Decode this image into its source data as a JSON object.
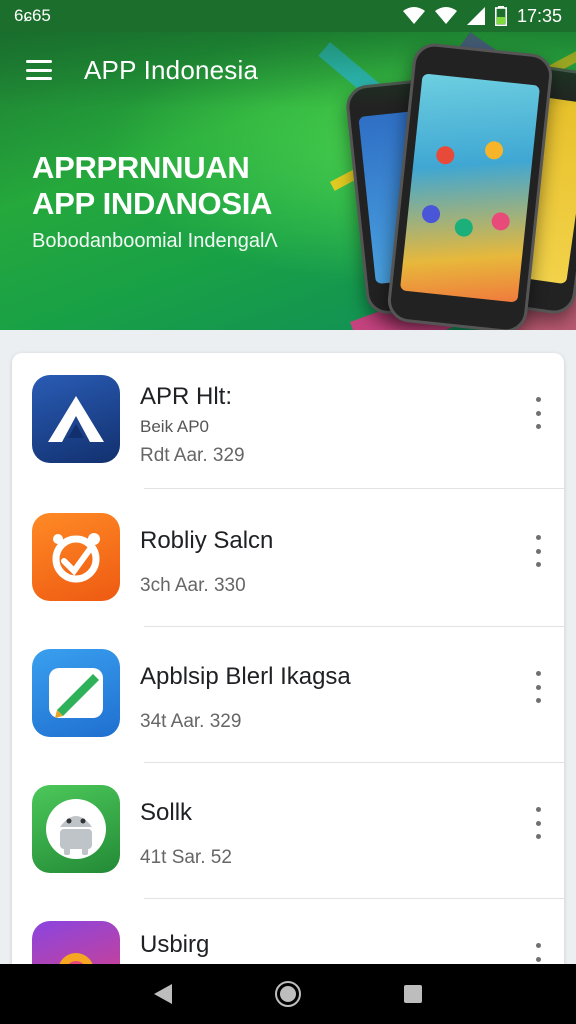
{
  "status_bar": {
    "left_text": "6ɕ65",
    "time": "17:35",
    "icons": [
      "wifi-icon",
      "signal-icon",
      "battery-icon"
    ]
  },
  "header": {
    "title": "APP Indonesia",
    "menu_icon": "menu-icon"
  },
  "hero": {
    "headline_line1": "APRPRNNUAN",
    "headline_line2": "APP INDΛNOSIA",
    "subtitle": "Bobodanboomial IndengalΛ"
  },
  "apps": [
    {
      "name": "APR Hlt:",
      "subtitle": "Beik AP0",
      "meta": "Rdt Aar. 329",
      "icon": "triangle-logo-icon",
      "color": "#1f4a9a"
    },
    {
      "name": "Robliy Salcn",
      "subtitle": "",
      "meta": "3ch Aar. 330",
      "icon": "orange-gear-icon",
      "color": "#f27a1a"
    },
    {
      "name": "Apblsip Blerl Ikagsa",
      "subtitle": "",
      "meta": "34t Aar. 329",
      "icon": "pen-icon",
      "color": "#2b8bdf"
    },
    {
      "name": "Sollk",
      "subtitle": "",
      "meta": "41t Sar. 52",
      "icon": "android-icon",
      "color": "#3aa845"
    },
    {
      "name": "Usbirg",
      "subtitle": "",
      "meta": "",
      "icon": "purple-app-icon",
      "color": "#7a3bd0"
    }
  ],
  "nav": {
    "back_icon": "back-icon",
    "home_icon": "home-icon",
    "recents_icon": "recents-icon"
  }
}
